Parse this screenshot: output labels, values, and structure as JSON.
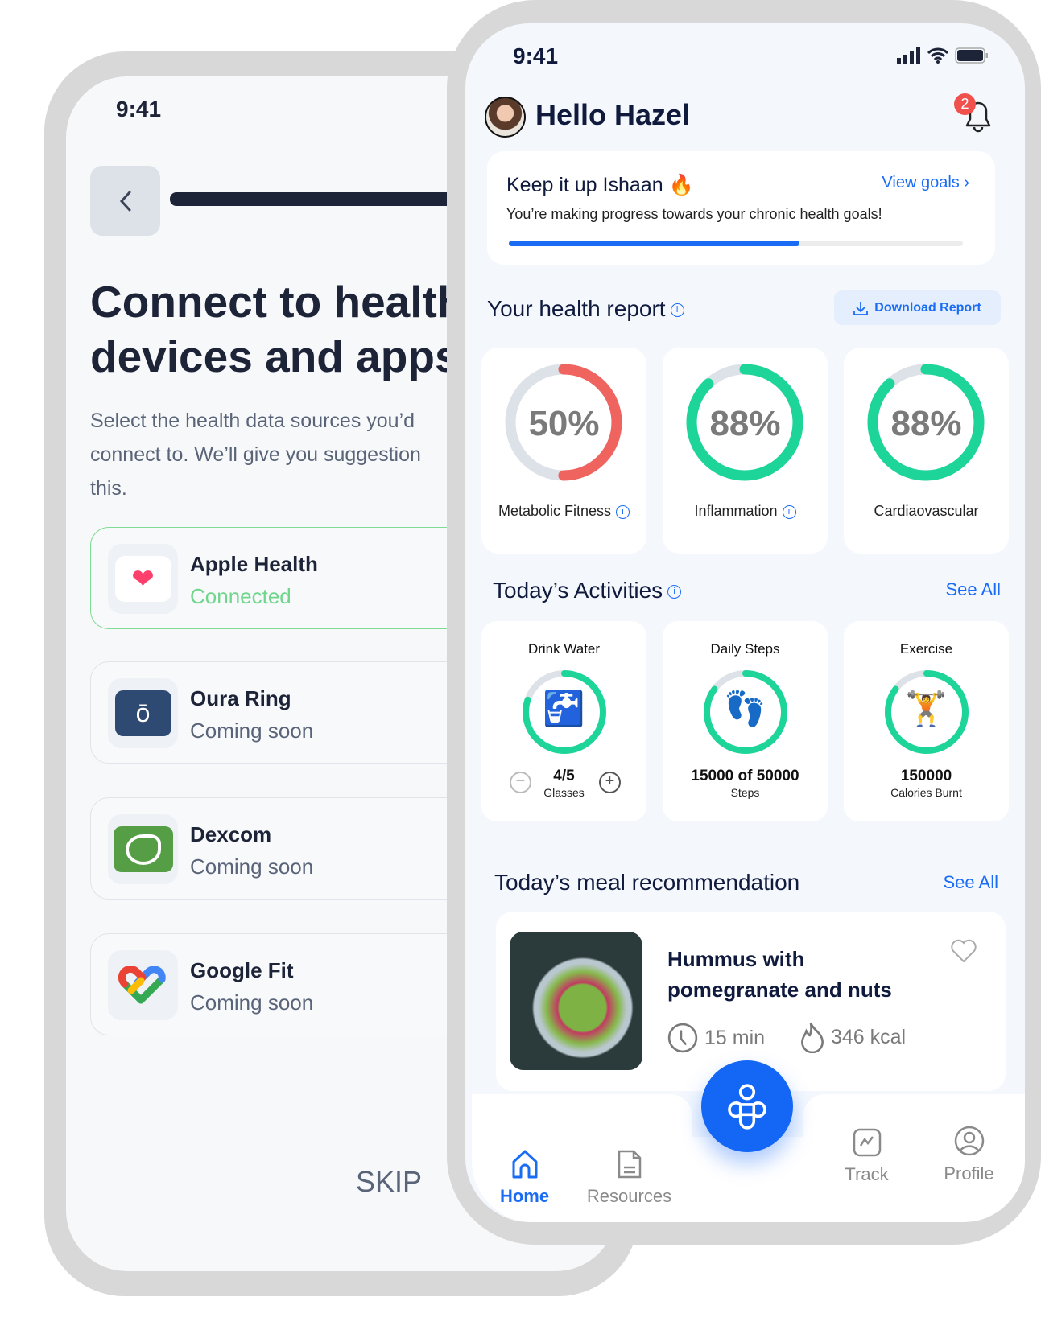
{
  "onboarding": {
    "time": "9:41",
    "title_lines": [
      "Connect to health",
      "devices and apps"
    ],
    "subtitle_lines": [
      "Select the health data sources you’d",
      "connect to. We’ll give you suggestion",
      "this."
    ],
    "devices": [
      {
        "name": "Apple Health",
        "status": "Connected",
        "icon": "heart-icon"
      },
      {
        "name": "Oura Ring",
        "status": "Coming soon",
        "icon": "oura-ring-icon"
      },
      {
        "name": "Dexcom",
        "status": "Coming soon",
        "icon": "dexcom-icon"
      },
      {
        "name": "Google Fit",
        "status": "Coming soon",
        "icon": "google-fit-icon"
      }
    ],
    "skip_label": "SKIP"
  },
  "home": {
    "time": "9:41",
    "greeting": "Hello Hazel",
    "notification_count": "2",
    "goal_card": {
      "title": "Keep it up Ishaan 🔥",
      "link": "View goals",
      "subtitle": "You’re making progress towards your chronic health goals!",
      "progress_percent": 64
    },
    "health_report": {
      "title": "Your health report",
      "download_label": "Download Report",
      "items": [
        {
          "percent": "50%",
          "value": 50,
          "label": "Metabolic Fitness",
          "color": "#f0645f"
        },
        {
          "percent": "88%",
          "value": 88,
          "label": "Inflammation",
          "color": "#1dd598"
        },
        {
          "percent": "88%",
          "value": 88,
          "label": "Cardiaovascular",
          "color": "#1dd598"
        }
      ]
    },
    "activities": {
      "title": "Today’s Activities",
      "see_all": "See All",
      "items": [
        {
          "title": "Drink Water",
          "emoji": "🚰",
          "value": "4/5",
          "sub": "Glasses",
          "progress": 80
        },
        {
          "title": "Daily Steps",
          "emoji": "👣",
          "value": "15000 of 50000",
          "sub": "Steps",
          "progress": 85
        },
        {
          "title": "Exercise",
          "emoji": "🏋️",
          "value": "150000",
          "sub": "Calories Burnt",
          "progress": 85
        }
      ]
    },
    "meal": {
      "title": "Today’s meal recommendation",
      "see_all": "See All",
      "name_lines": [
        "Hummus with",
        "pomegranate and nuts"
      ],
      "time": "15 min",
      "kcal": "346 kcal"
    },
    "nav": [
      {
        "label": "Home",
        "active": true
      },
      {
        "label": "Resources"
      },
      {
        "label": "Track"
      },
      {
        "label": "Profile"
      }
    ],
    "colors": {
      "accent": "#1a6cf5",
      "green": "#1dd598",
      "red": "#f0645f",
      "navy": "#0f1a3d"
    }
  }
}
